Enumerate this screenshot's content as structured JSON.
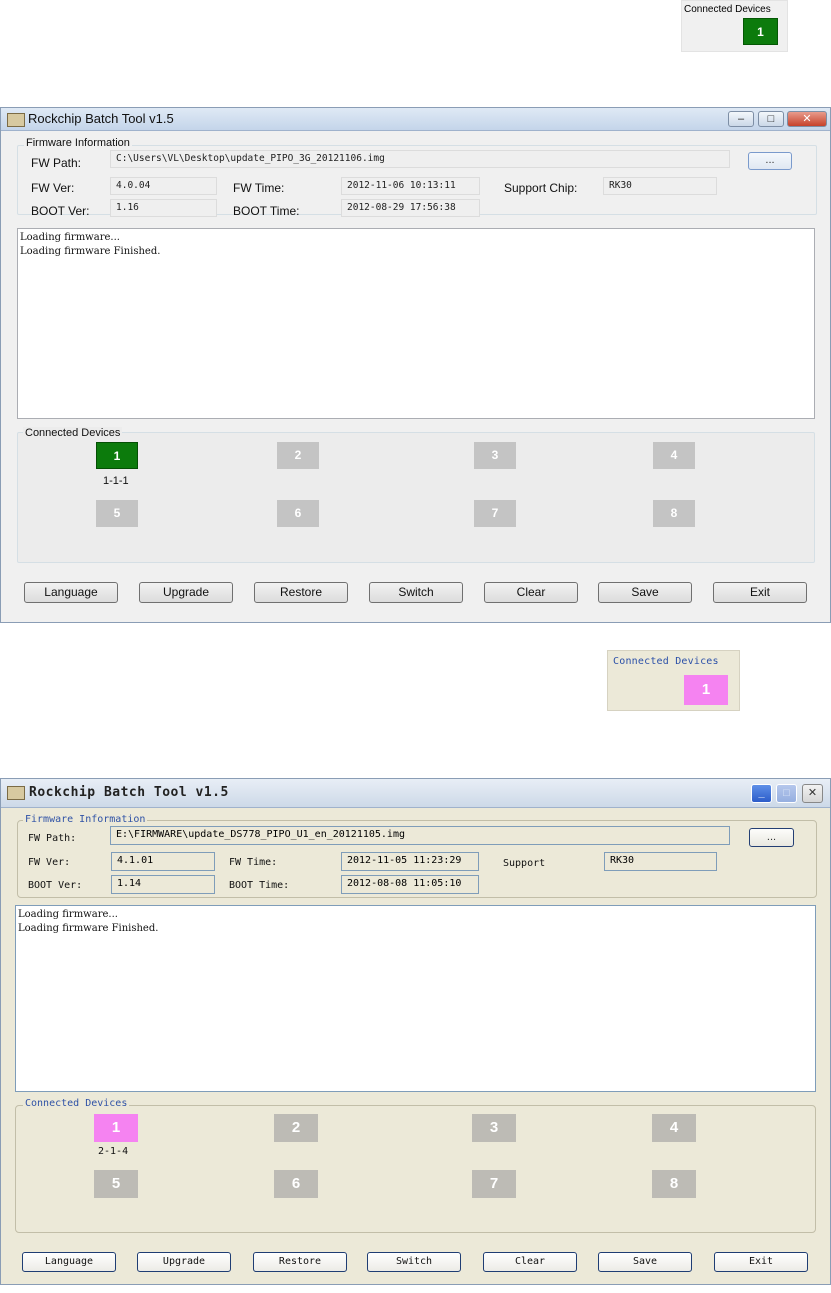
{
  "thumb_top": {
    "label": "Connected Devices",
    "device": "1",
    "color": "#0c7b0c"
  },
  "thumb_mid": {
    "label": "Connected Devices",
    "device": "1",
    "color": "#f583f1"
  },
  "window1": {
    "title": "Rockchip Batch Tool v1.5",
    "controls": {
      "minimize": "–",
      "maximize": "□",
      "close": "✕"
    },
    "firmware": {
      "group_label": "Firmware Information",
      "fw_path_label": "FW Path:",
      "fw_path": "C:\\Users\\VL\\Desktop\\update_PIPO_3G_20121106.img",
      "browse_label": "...",
      "fw_ver_label": "FW Ver:",
      "fw_ver": "4.0.04",
      "fw_time_label": "FW Time:",
      "fw_time": "2012-11-06 10:13:11",
      "support_chip_label": "Support Chip:",
      "support_chip": "RK30",
      "boot_ver_label": "BOOT Ver:",
      "boot_ver": "1.16",
      "boot_time_label": "BOOT Time:",
      "boot_time": "2012-08-29 17:56:38"
    },
    "log": [
      "Loading firmware...",
      "Loading firmware Finished."
    ],
    "devices": {
      "group_label": "Connected Devices",
      "items": [
        "1",
        "2",
        "3",
        "4",
        "5",
        "6",
        "7",
        "8"
      ],
      "active_sub": "1-1-1"
    },
    "buttons": [
      "Language",
      "Upgrade",
      "Restore",
      "Switch",
      "Clear",
      "Save",
      "Exit"
    ]
  },
  "window2": {
    "title": "Rockchip Batch Tool v1.5",
    "controls": {
      "minimize": "_",
      "maximize": "□",
      "close": "✕"
    },
    "firmware": {
      "group_label": "Firmware Information",
      "fw_path_label": "FW Path:",
      "fw_path": "E:\\FIRMWARE\\update_DS778_PIPO_U1_en_20121105.img",
      "browse_label": "...",
      "fw_ver_label": "FW Ver:",
      "fw_ver": "4.1.01",
      "fw_time_label": "FW Time:",
      "fw_time": "2012-11-05 11:23:29",
      "support_chip_label": "Support",
      "support_chip": "RK30",
      "boot_ver_label": "BOOT Ver:",
      "boot_ver": "1.14",
      "boot_time_label": "BOOT Time:",
      "boot_time": "2012-08-08 11:05:10"
    },
    "log": [
      "Loading firmware...",
      "Loading firmware Finished."
    ],
    "devices": {
      "group_label": "Connected Devices",
      "items": [
        "1",
        "2",
        "3",
        "4",
        "5",
        "6",
        "7",
        "8"
      ],
      "active_sub": "2-1-4"
    },
    "buttons": [
      "Language",
      "Upgrade",
      "Restore",
      "Switch",
      "Clear",
      "Save",
      "Exit"
    ]
  }
}
